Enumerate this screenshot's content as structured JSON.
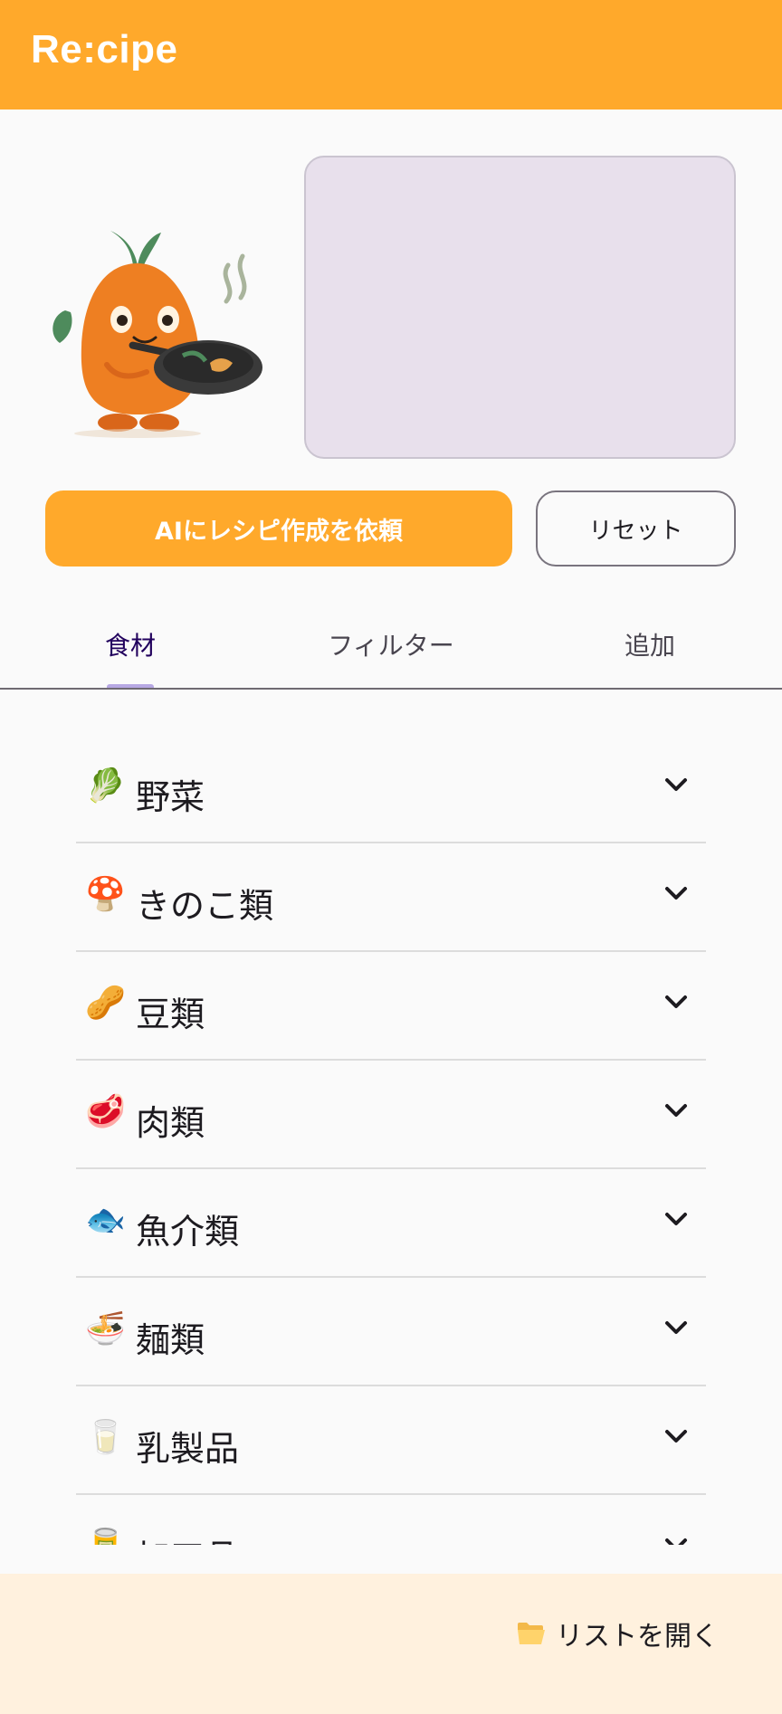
{
  "app": {
    "title": "Re:cipe"
  },
  "actions": {
    "ai_request_label": "AIにレシピ作成を依頼",
    "reset_label": "リセット"
  },
  "tabs": [
    {
      "label": "食材",
      "active": true
    },
    {
      "label": "フィルター",
      "active": false
    },
    {
      "label": "追加",
      "active": false
    }
  ],
  "categories": [
    {
      "emoji": "🥬",
      "label": "野菜"
    },
    {
      "emoji": "🍄",
      "label": "きのこ類"
    },
    {
      "emoji": "🥜",
      "label": "豆類"
    },
    {
      "emoji": "🥩",
      "label": "肉類"
    },
    {
      "emoji": "🐟",
      "label": "魚介類"
    },
    {
      "emoji": "🍜",
      "label": "麺類"
    },
    {
      "emoji": "🥛",
      "label": "乳製品"
    },
    {
      "emoji": "🥫",
      "label": "加工品"
    }
  ],
  "bottom": {
    "open_list_label": "リストを開く",
    "open_list_icon": "folder-open-icon"
  },
  "colors": {
    "accent": "#ffa92b",
    "tab_active": "#21005d",
    "bottom_bar": "#fff1de"
  }
}
